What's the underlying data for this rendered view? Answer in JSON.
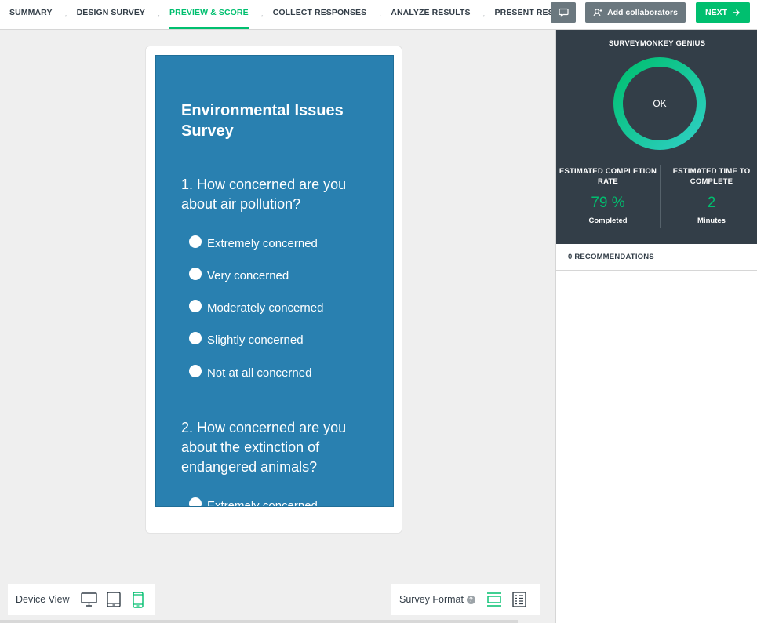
{
  "nav": {
    "steps": [
      {
        "label": "SUMMARY"
      },
      {
        "label": "DESIGN SURVEY"
      },
      {
        "label": "PREVIEW & SCORE"
      },
      {
        "label": "COLLECT RESPONSES"
      },
      {
        "label": "ANALYZE RESULTS"
      },
      {
        "label": "PRESENT RESULTS"
      }
    ],
    "active_step": "PREVIEW & SCORE",
    "arrow": "→",
    "add_collaborators_label": "Add collaborators",
    "next_label": "NEXT"
  },
  "survey": {
    "title": "Environmental Issues Survey",
    "questions": [
      {
        "text": "1. How concerned are you about air pollution?",
        "options": [
          "Extremely concerned",
          "Very concerned",
          "Moderately concerned",
          "Slightly concerned",
          "Not at all concerned"
        ]
      },
      {
        "text": "2. How concerned are you about the extinction of endangered animals?",
        "options": [
          "Extremely concerned"
        ]
      }
    ]
  },
  "device_view": {
    "label": "Device View",
    "options": [
      {
        "icon": "desktop-icon"
      },
      {
        "icon": "tablet-icon"
      },
      {
        "icon": "mobile-icon",
        "selected": true
      }
    ]
  },
  "survey_format": {
    "label": "Survey Format",
    "help": "?",
    "options": [
      {
        "icon": "one-question-at-a-time-icon",
        "selected": true
      },
      {
        "icon": "classic-format-icon"
      }
    ]
  },
  "genius": {
    "title": "SURVEYMONKEY GENIUS",
    "score_label": "OK",
    "completion_rate_heading": "ESTIMATED COMPLETION RATE",
    "completion_rate_value": "79 %",
    "completion_rate_unit": "Completed",
    "completion_rate_fraction": 0.79,
    "time_heading": "ESTIMATED TIME TO COMPLETE",
    "time_value": "2",
    "time_unit": "Minutes",
    "recommendations": "0 RECOMMENDATIONS"
  },
  "colors": {
    "accent": "#00bf6f",
    "survey_bg": "#2980b0",
    "panel_dark": "#333e48",
    "button_gray": "#6b787f"
  }
}
